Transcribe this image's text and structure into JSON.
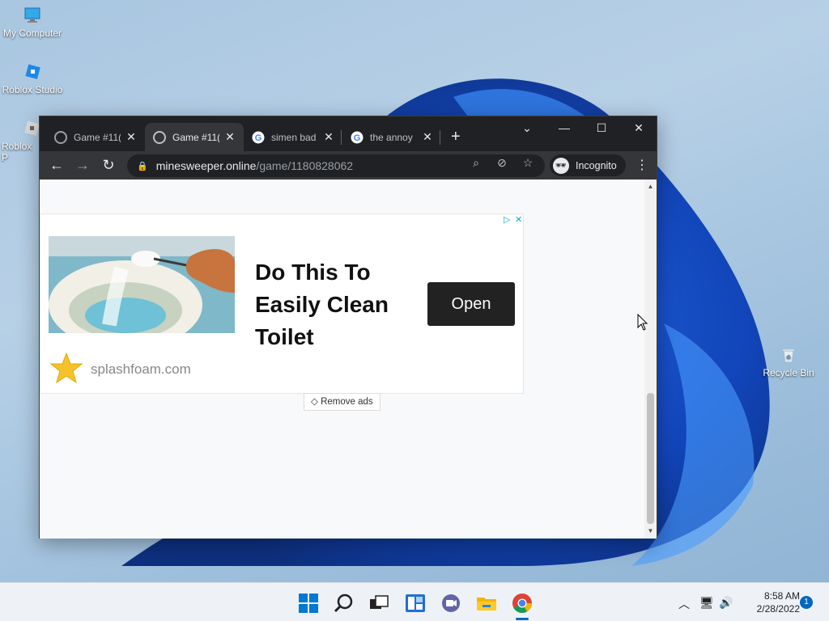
{
  "desktop": {
    "icons": [
      {
        "label": "My Computer"
      },
      {
        "label": "Roblox Studio"
      },
      {
        "label": "Roblox P"
      },
      {
        "label": "Recycle Bin"
      }
    ]
  },
  "browser": {
    "tabs": [
      {
        "title": "Game #11(",
        "active": false
      },
      {
        "title": "Game #11(",
        "active": true
      },
      {
        "title": "simen bad",
        "active": false
      },
      {
        "title": "the annoy",
        "active": false
      }
    ],
    "url_host": "minesweeper.online",
    "url_path": "/game/1180828062",
    "incognito_label": "Incognito",
    "incognito_avatar": "🕶"
  },
  "ad": {
    "headline": "Do This To Easily Clean Toilet",
    "cta": "Open",
    "domain": "splashfoam.com",
    "remove_ads": "Remove ads"
  },
  "taskbar": {
    "time": "8:58 AM",
    "date": "2/28/2022",
    "notifications": "1"
  },
  "colors": {
    "accent": "#0067c0",
    "chrome_dark": "#202124",
    "chrome_toolbar": "#35363a"
  }
}
